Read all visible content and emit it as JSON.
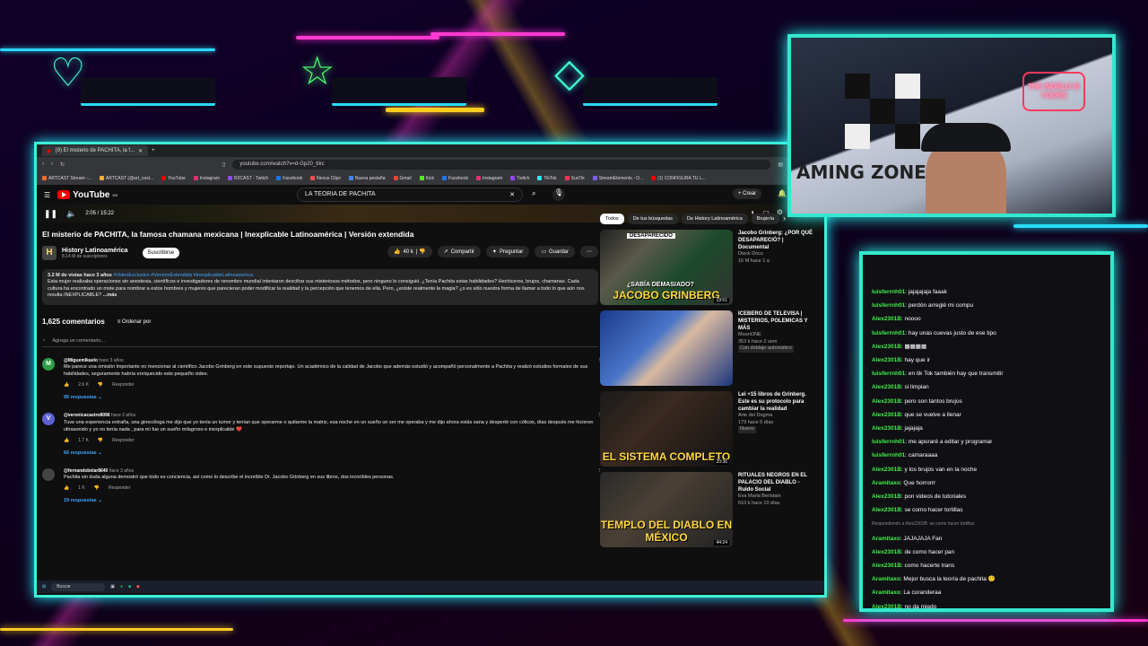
{
  "browser": {
    "tab_title": "(9) El misterio de PACHITA, la f...",
    "url": "youtube.com/watch?v=d-Gp20_tIkc",
    "bookmarks": [
      {
        "label": "ARTCAST Stream -...",
        "color": "#ff6b2b"
      },
      {
        "label": "ARTCAST (@art_cast...",
        "color": "#ffb02e"
      },
      {
        "label": "YouTube",
        "color": "#ff0000"
      },
      {
        "label": "Instagram",
        "color": "#e1306c"
      },
      {
        "label": "R2CAST - Twitch",
        "color": "#9146ff"
      },
      {
        "label": "Facebook",
        "color": "#1877f2"
      },
      {
        "label": "Nexus Clips",
        "color": "#ff4d4d"
      },
      {
        "label": "Nueva pestaña",
        "color": "#4285f4"
      },
      {
        "label": "Gmail",
        "color": "#ea4335"
      },
      {
        "label": "Kick",
        "color": "#53fc18"
      },
      {
        "label": "Facebook",
        "color": "#1877f2"
      },
      {
        "label": "Instagram",
        "color": "#e1306c"
      },
      {
        "label": "Twitch",
        "color": "#9146ff"
      },
      {
        "label": "TikTok",
        "color": "#25f4ee"
      },
      {
        "label": "SusTik",
        "color": "#ff3355"
      },
      {
        "label": "StreamElements - O...",
        "color": "#7b5cff"
      },
      {
        "label": "(1) CONFIGURA TU L...",
        "color": "#ff0000"
      }
    ]
  },
  "youtube": {
    "logo": "YouTube",
    "logo_region": "MX",
    "search_value": "LA TEORIA DE PACHITA",
    "create_label": "Crear",
    "player_time": "2:05 / 15:22",
    "video_title": "El misterio de PACHITA, la famosa chamana mexicana | Inexplicable Latinoamérica | Versión extendida",
    "channel": {
      "name": "History Latinoamérica",
      "subs": "8.14 M de suscriptores",
      "avatar": "H",
      "subscribe_label": "Suscribirse"
    },
    "actions": {
      "likes": "40 k",
      "share": "Compartir",
      "ask": "Preguntar",
      "save": "Guardar"
    },
    "description": {
      "stats": "3.2 M de vistas  hace 3 años",
      "tags": "#VideoExclusivo #VersionExtendida #InexplicableLatinoamerica",
      "text": "Esta mujer realizaba operaciones sin anestesia, científicos e investigadores de renombre mundial intentaron descifrar sus misteriosos métodos, pero ninguno lo consiguió. ¿Tenía Pachita estas habilidades? Hechiceros, brujos, chamanas. Cada cultura ha encontrado un mote para nombrar a estos hombres y mujeres que parecieran poder modificar la realidad y la percepción que tenemos de ella. Pero, ¿existe realmente la magia? ¿o es sólo nuestra forma de llamar a todo lo que aún nos resulta INEXPLICABLE?",
      "more": "...más"
    },
    "comments_count": "1,625 comentarios",
    "sort_label": "Ordenar por",
    "add_comment": "Agrega un comentario...",
    "comments": [
      {
        "avatar": "M",
        "color": "#2e9e48",
        "user": "@Miguemlkaelo",
        "time": "hace 3 años",
        "text": "Me parece una omisión importante no mencionar al científico Jacobo Grinberg en este supuesto reportaje. Un académico de la calidad de Jacobo que además estudió y acompañó personalmente a Pachita y realizó estudios formales de sus habilidades, seguramente habría enriquecido este pequeño video.",
        "likes": "2.6 K",
        "reply": "Responder",
        "replies": "95 respuestas"
      },
      {
        "avatar": "V",
        "color": "#5b63d6",
        "user": "@veronicacastro8096",
        "time": "hace 2 años",
        "text": "Tuve una experiencia extraña, una ginecóloga me dijo que yo tenía un tumor y tenían que operarme o quitarme la matriz, esa noche en un sueño un ser me operaba y me dijo ahora estás sana y desperté con cólicos, días después me hicieron ultrasonido y yo no tenía nada , para mí fue un sueño milagroso e inexplicable ❤️",
        "likes": "1.7 K",
        "reply": "Responder",
        "replies": "66 respuestas"
      },
      {
        "avatar": "",
        "color": "#444",
        "user": "@fernandobelar8640",
        "time": "hace 3 años",
        "text": "Pachita sin duda alguna demostró que todo es conciencia, así como lo describe el increíble Dr. Jacobo Grinberg en sus libros, dos increíbles personas.",
        "likes": "1 K",
        "reply": "Responder",
        "replies": "19 respuestas"
      }
    ],
    "chips": [
      {
        "label": "Todos",
        "active": true
      },
      {
        "label": "De tus búsquedas",
        "active": false
      },
      {
        "label": "De History Latinoamérica",
        "active": false
      },
      {
        "label": "Brujería",
        "active": false
      }
    ],
    "recommendations": [
      {
        "title": "Jacobo Grinberg: ¿POR QUÉ DESAPARECIÓ? | Documental",
        "channel": "Dieck Docs",
        "meta": "16 M  hace 1 a",
        "caption": "JACOBO GRINBERG",
        "overlay": "¿SABÍA DEMASIADO?",
        "top": "DESAPARECIDO",
        "duration": "19:51",
        "bg": "linear-gradient(135deg,#222 0%,#5a5a4a 30%,#1d4a2a 60%,#333 100%)"
      },
      {
        "title": "ICEBERG DE TELEVISA | MISTERIOS, POLEMICAS Y MÁS",
        "channel": "MoonONE",
        "meta": "353 k  hace 2 sem",
        "extra": "Con doblaje automático",
        "caption": "",
        "overlay": "",
        "top": "",
        "duration": "",
        "bg": "linear-gradient(135deg,#1a3a8a 0%,#4a76c8 40%,#d8b9a0 55%,#1c3680 100%)"
      },
      {
        "title": "Lei +15 libros de Grinberg. Este es su protocolo para cambiar la realidad",
        "channel": "Arte del Dogma",
        "meta": "179  hace 5 días",
        "extra": "Nuevo",
        "caption": "EL SISTEMA COMPLETO",
        "overlay": "",
        "top": "",
        "duration": "20:36",
        "bg": "linear-gradient(135deg,#1b1b1b 0%,#3a2a20 40%,#111 100%)"
      },
      {
        "title": "RITUALES NEGROS EN EL PALACIO DEL DIABLO - Ruido Social",
        "channel": "Eva Maria Beristain",
        "meta": "610 k  hace 10 días",
        "caption": "TEMPLO DEL DIABLO EN MÉXICO",
        "overlay": "",
        "top": "",
        "duration": "44:24",
        "bg": "linear-gradient(135deg,#2a2a2a 0%,#4a4035 40%,#222 100%)"
      }
    ],
    "taskbar_search": "Buscar"
  },
  "webcam": {
    "sign": "THE WORLD IS YOURS",
    "brand": "AMING ZONE"
  },
  "chat": [
    {
      "user": "luisferrnh01",
      "text": "jajajajaja faaak"
    },
    {
      "user": "luisferrnh01",
      "text": "perdón arreglé mi compu"
    },
    {
      "user": "Alex2301B",
      "text": "noooo"
    },
    {
      "user": "luisferrnh01",
      "text": "hay unas cuevas justo de ese tipo"
    },
    {
      "user": "Alex2301B",
      "text": "▩▩▩▩"
    },
    {
      "user": "Alex2301B",
      "text": "hay que ir"
    },
    {
      "user": "luisferrnh01",
      "text": "en tik Tok también hay que transmitir"
    },
    {
      "user": "Alex2301B",
      "text": "si limpian"
    },
    {
      "user": "Alex2301B",
      "text": "pero son tantos brujos"
    },
    {
      "user": "Alex2301B",
      "text": "que se vuelve a llenar"
    },
    {
      "user": "Alex2301B",
      "text": "jajajaja"
    },
    {
      "user": "luisferrnh01",
      "text": "me apuraré a editar y programar"
    },
    {
      "user": "luisferrnh01",
      "text": "camaraaaa"
    },
    {
      "user": "Alex2301B",
      "text": "y los brujos van en la noche"
    },
    {
      "user": "Aramitaxo",
      "text": "Que horrorrr"
    },
    {
      "user": "Alex2301B",
      "text": "pon videos de tutoriales"
    },
    {
      "user": "Alex2301B",
      "text": "se como hacer tortillas"
    },
    {
      "user": "Aramitaxo",
      "text": "JAJAJAJA Fan",
      "reply": "Respondiendo a Alex2301B: se como hacer tortillas"
    },
    {
      "user": "Alex2301B",
      "text": "de como hacer pan"
    },
    {
      "user": "Alex2301B",
      "text": "como hacerte trans"
    },
    {
      "user": "Aramitaxo",
      "text": "Mejor busca la teoría de pachita 🙂"
    },
    {
      "user": "Aramitaxo",
      "text": "La curanderaa"
    },
    {
      "user": "Alex2301B",
      "text": "no da miedo"
    }
  ]
}
